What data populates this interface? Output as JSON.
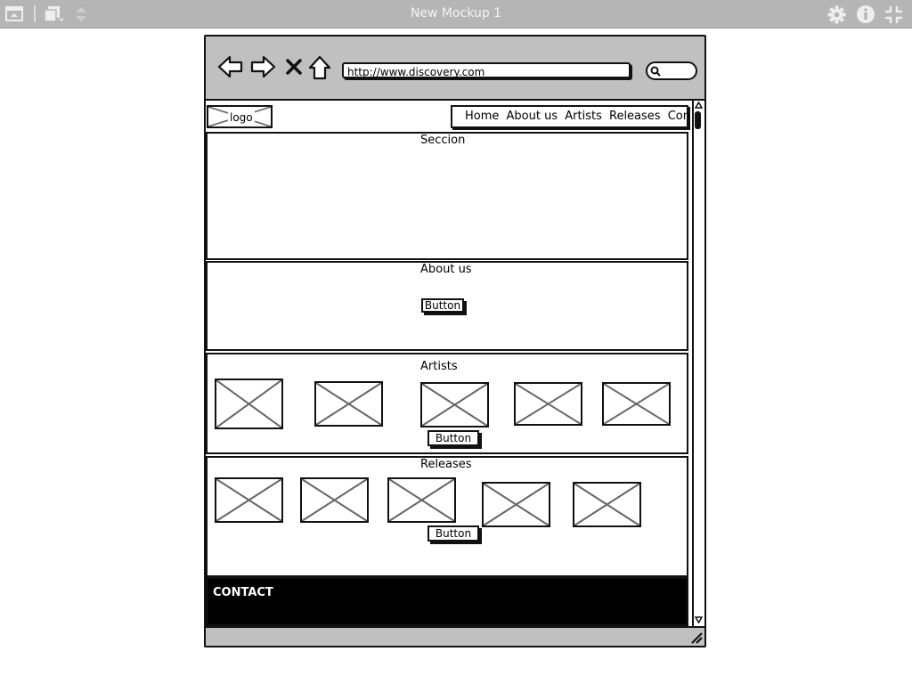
{
  "app": {
    "title": "New Mockup 1"
  },
  "browser": {
    "url": "http://www.discovery.com"
  },
  "page": {
    "logo_label": "logo",
    "nav": [
      "Home",
      "About us",
      "Artists",
      "Releases",
      "Contact"
    ],
    "sections": {
      "seccion_title": "Seccion",
      "about_title": "About us",
      "about_button": "Button",
      "artists_title": "Artists",
      "artists_button": "Button",
      "releases_title": "Releases",
      "releases_button": "Button",
      "contact_title": "CONTACT"
    }
  },
  "icons": {
    "toolbar": [
      "window-icon",
      "copy-icon",
      "up-down-arrows-icon",
      "gear-icon",
      "info-icon",
      "fullscreen-icon"
    ],
    "browser": [
      "back-arrow-icon",
      "forward-arrow-icon",
      "close-x-icon",
      "home-icon",
      "search-icon",
      "resize-handle-icon"
    ]
  },
  "colors": {
    "appbar": "#b5b5b5",
    "chrome": "#c0c0c0",
    "ink": "#111111",
    "contact_bg": "#000000"
  }
}
